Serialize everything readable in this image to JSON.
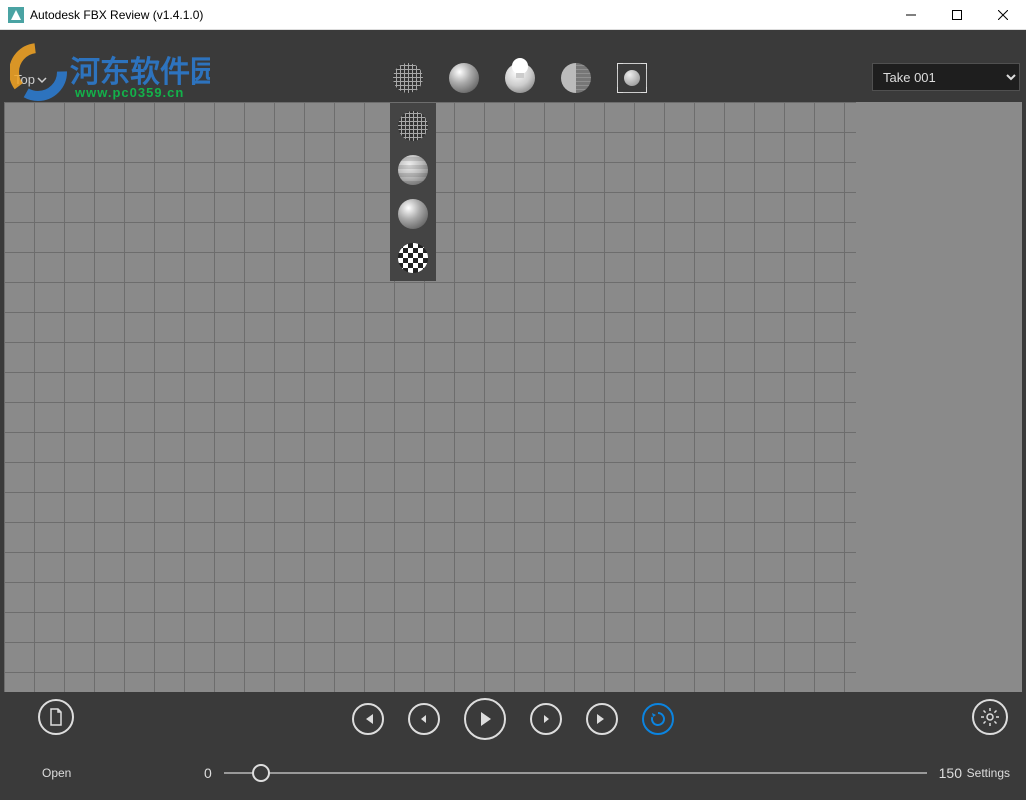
{
  "window": {
    "title": "Autodesk FBX Review (v1.4.1.0)"
  },
  "watermark": {
    "text": "河东软件园",
    "url": "www.pc0359.cn"
  },
  "viewport": {
    "view_label": "Top"
  },
  "take": {
    "selected": "Take 001"
  },
  "timeline": {
    "start": "0",
    "end": "150"
  },
  "bottom": {
    "open_label": "Open",
    "settings_label": "Settings"
  },
  "colors": {
    "accent": "#0b84e0",
    "viewport_bg": "#8a8a8a",
    "panel_bg": "#3a3a3a"
  }
}
